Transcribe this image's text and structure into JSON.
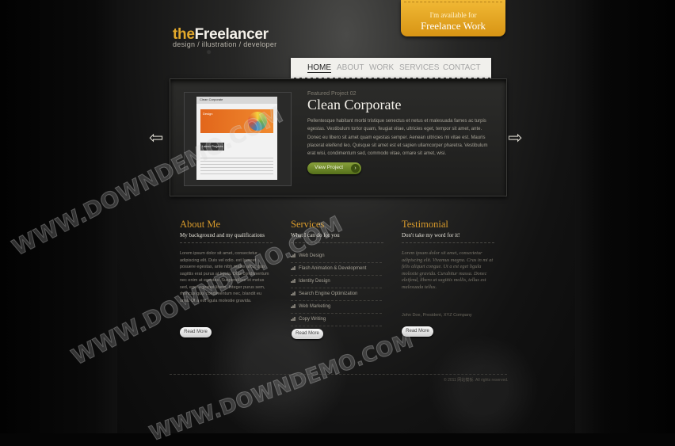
{
  "brand": {
    "logo_the": "the",
    "logo_name": "Freelancer",
    "tagline": "design / illustration / developer"
  },
  "ribbon": {
    "line1": "I'm available for",
    "line2": "Freelance Work"
  },
  "nav": {
    "items": [
      {
        "label": "HOME"
      },
      {
        "label": "ABOUT"
      },
      {
        "label": "WORK"
      },
      {
        "label": "SERVICES"
      },
      {
        "label": "CONTACT"
      }
    ]
  },
  "featured": {
    "eyebrow": "Featured Project 02",
    "title": "Clean Corporate",
    "text": "Pellentesque habitant morbi tristique senectus et netus et malesuada fames ac turpis egestas. Vestibulum tortor quam, feugiat vitae, ultricies eget, tempor sit amet, ante. Donec eu libero sit amet quam egestas semper. Aenean ultricies mi vitae est. Mauris placerat eleifend leo. Quisque sit amet est et sapien ullamcorper pharetra. Vestibulum erat wisi, condimentum sed, commodo vitae, ornare sit amet, wisi.",
    "button": "View Project",
    "thumb_header": "Clean Corporate",
    "thumb_hero": "Design",
    "thumb_box": "Latest Projects"
  },
  "about": {
    "title": "About Me",
    "subtitle": "My background and my qualifications",
    "text": "Lorem ipsum dolor sit amet, consectetur adipiscing elit. Duis vel odio. est laoreet posuere egestas, ante nibh mattis arcu, quis sagittis erat purus at ligula. Duis condimentum nec enim at egestas. Suspendisse et metus sed, eget egestas libero. Integer purus sem, rhoncus quis condimentum nec, blandit eu urna. Ut a est ligula molestie gravida.",
    "button": "Read More"
  },
  "services": {
    "title": "Services",
    "subtitle": "What I can do for you",
    "items": [
      {
        "label": "Web Design"
      },
      {
        "label": "Flash Animation & Development"
      },
      {
        "label": "Identity Design"
      },
      {
        "label": "Search Engine Optimization"
      },
      {
        "label": "Web Marketing"
      },
      {
        "label": "Copy Writing"
      }
    ],
    "button": "Read More"
  },
  "testimonial": {
    "title": "Testimonial",
    "subtitle": "Don't take my word for it!",
    "quote": "Lorem ipsum dolor sit amet, consectetur adipiscing elit. Vivamus magna. Cras in mi at felis aliquet congue. Ut a est eget ligula molestie gravida. Curabitur massa. Donec eleifend, libero at sagittis mollis, tellus est malesuada tellus.",
    "cite": "John Doe, President, XYZ Company",
    "button": "Read More"
  },
  "footer": {
    "text": "© 2011 网站模板. All rights reserved."
  },
  "arrows": {
    "prev": "⇦",
    "next": "⇨"
  },
  "watermark": {
    "text": "WWW.DOWNDEMO.COM"
  }
}
